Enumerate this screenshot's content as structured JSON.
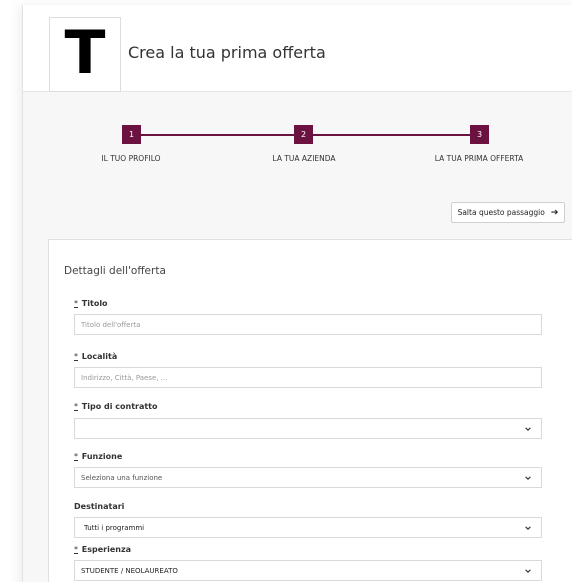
{
  "header": {
    "logo_letter": "T",
    "title": "Crea la tua prima offerta"
  },
  "steps": [
    {
      "number": "1",
      "label": "IL TUO PROFILO"
    },
    {
      "number": "2",
      "label": "LA TUA AZIENDA"
    },
    {
      "number": "3",
      "label": "LA TUA PRIMA OFFERTA"
    }
  ],
  "skip_button": {
    "label": "Salta questo passaggio",
    "icon": "arrow-right-icon"
  },
  "form": {
    "title": "Dettagli dell'offerta",
    "required_mark": "*",
    "fields": {
      "titolo": {
        "label": "Titolo",
        "placeholder": "Titolo dell'offerta"
      },
      "localita": {
        "label": "Località",
        "placeholder": "Indirizzo, Città, Paese, ..."
      },
      "tipo_contratto": {
        "label": "Tipo di contratto",
        "value": ""
      },
      "funzione": {
        "label": "Funzione",
        "value": "Seleziona una funzione"
      },
      "destinatari": {
        "label": "Destinatari",
        "value": "Tutti i programmi"
      },
      "esperienza": {
        "label": "Esperienza",
        "value": "STUDENTE / NEOLAUREATO"
      }
    }
  },
  "colors": {
    "accent": "#6b1240",
    "background": "#f7f7f7"
  }
}
